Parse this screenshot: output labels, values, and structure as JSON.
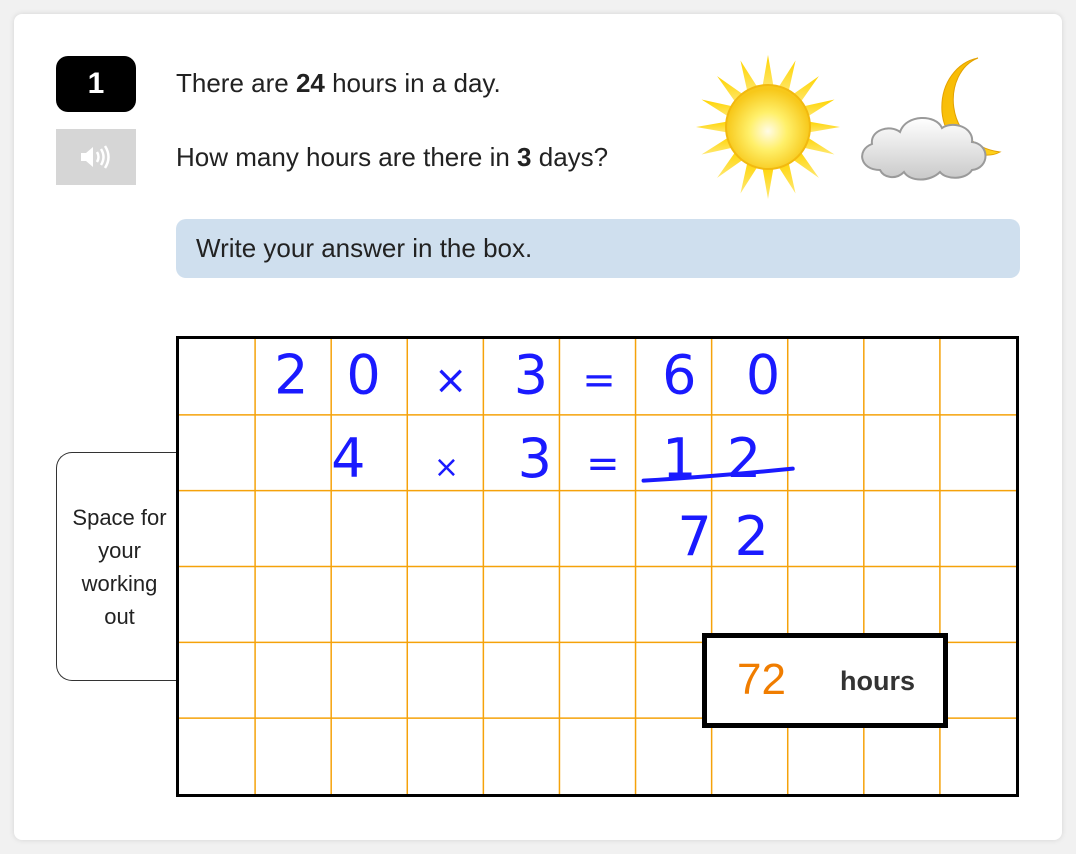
{
  "question": {
    "number": "1",
    "line1": {
      "pre": "There are ",
      "bold": "24",
      "post": " hours in a day."
    },
    "line2": {
      "pre": "How many hours are there in ",
      "bold": "3",
      "post": " days?"
    },
    "audio_icon": "speaker-icon",
    "images": [
      "sun-icon",
      "cloud-moon-icon"
    ]
  },
  "instruction": "Write your answer in the box.",
  "working_out": {
    "label": "Space for your working out",
    "grid": {
      "columns": 11,
      "rows": 6,
      "line_color": "#f5a20a",
      "border_color": "#000000"
    },
    "handwriting": {
      "ink_color": "#1a1aff",
      "rows": [
        [
          "2",
          "0",
          "×",
          "3",
          "=",
          "6",
          "0"
        ],
        [
          "4",
          "×",
          "3",
          "=",
          "1",
          "2"
        ],
        [
          "7",
          "2"
        ]
      ]
    }
  },
  "answer": {
    "value": "72",
    "unit": "hours",
    "value_color": "#f07d00"
  },
  "colors": {
    "instruction_bg": "#cfdfee",
    "qnum_bg": "#000000",
    "audio_bg": "#d6d6d6"
  }
}
